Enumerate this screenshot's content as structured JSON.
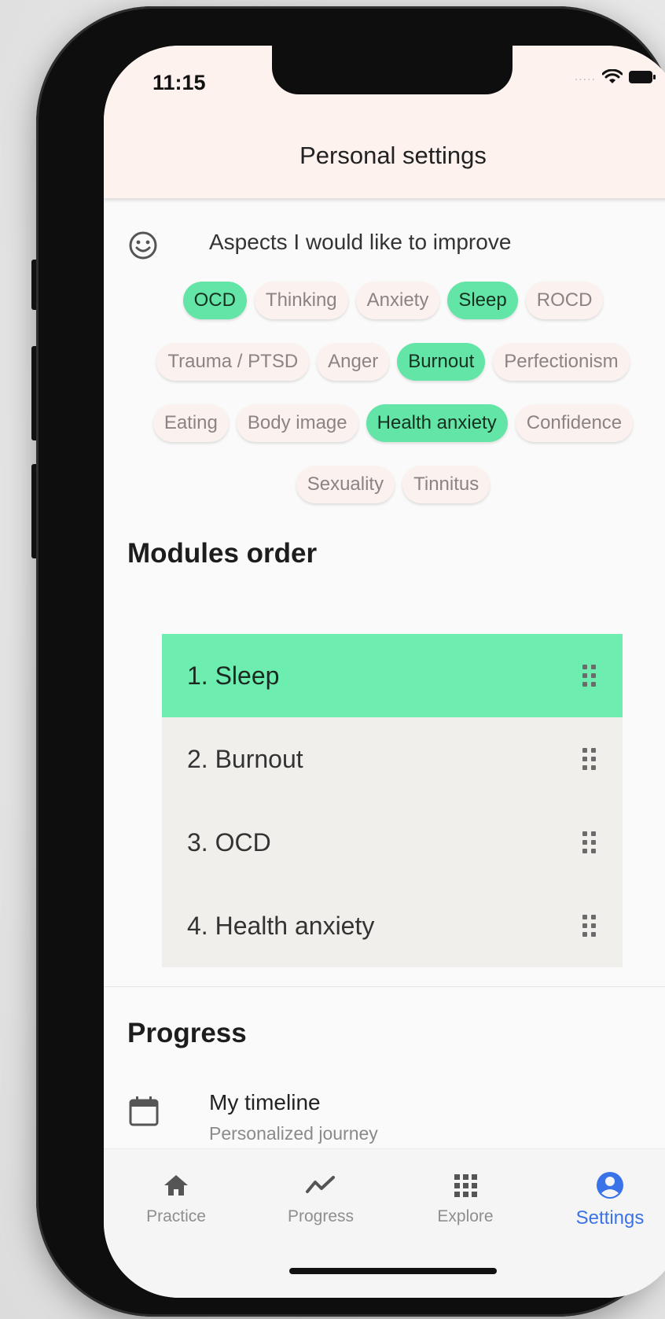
{
  "status_bar": {
    "time": "11:15",
    "signal": "....."
  },
  "header": {
    "title": "Personal settings"
  },
  "aspects": {
    "label": "Aspects I would like to improve",
    "chips_row1": [
      {
        "label": "OCD",
        "selected": true
      },
      {
        "label": "Thinking",
        "selected": false
      },
      {
        "label": "Anxiety",
        "selected": false
      },
      {
        "label": "Sleep",
        "selected": true
      },
      {
        "label": "ROCD",
        "selected": false
      }
    ],
    "chips_row2": [
      {
        "label": "Trauma / PTSD",
        "selected": false
      },
      {
        "label": "Anger",
        "selected": false
      },
      {
        "label": "Burnout",
        "selected": true
      },
      {
        "label": "Perfectionism",
        "selected": false
      }
    ],
    "chips_row3": [
      {
        "label": "Eating",
        "selected": false
      },
      {
        "label": "Body image",
        "selected": false
      },
      {
        "label": "Health anxiety",
        "selected": true
      },
      {
        "label": "Confidence",
        "selected": false
      }
    ],
    "chips_row4": [
      {
        "label": "Sexuality",
        "selected": false
      },
      {
        "label": "Tinnitus",
        "selected": false
      }
    ]
  },
  "modules_order": {
    "title": "Modules order",
    "items": [
      "1. Sleep",
      "2. Burnout",
      "3. OCD",
      "4. Health anxiety"
    ]
  },
  "progress": {
    "title": "Progress",
    "timeline_title": "My timeline",
    "timeline_subtitle": "Personalized journey"
  },
  "nav": {
    "items": [
      {
        "label": "Practice",
        "icon": "home-icon"
      },
      {
        "label": "Progress",
        "icon": "trend-icon"
      },
      {
        "label": "Explore",
        "icon": "grid-icon"
      },
      {
        "label": "Settings",
        "icon": "account-icon"
      }
    ],
    "active": "Settings"
  },
  "colors": {
    "selected_chip": "#63e5a7",
    "highlight_module": "#6eedb0",
    "header_bg": "#fdf2ee",
    "active_nav": "#3a72e8"
  }
}
